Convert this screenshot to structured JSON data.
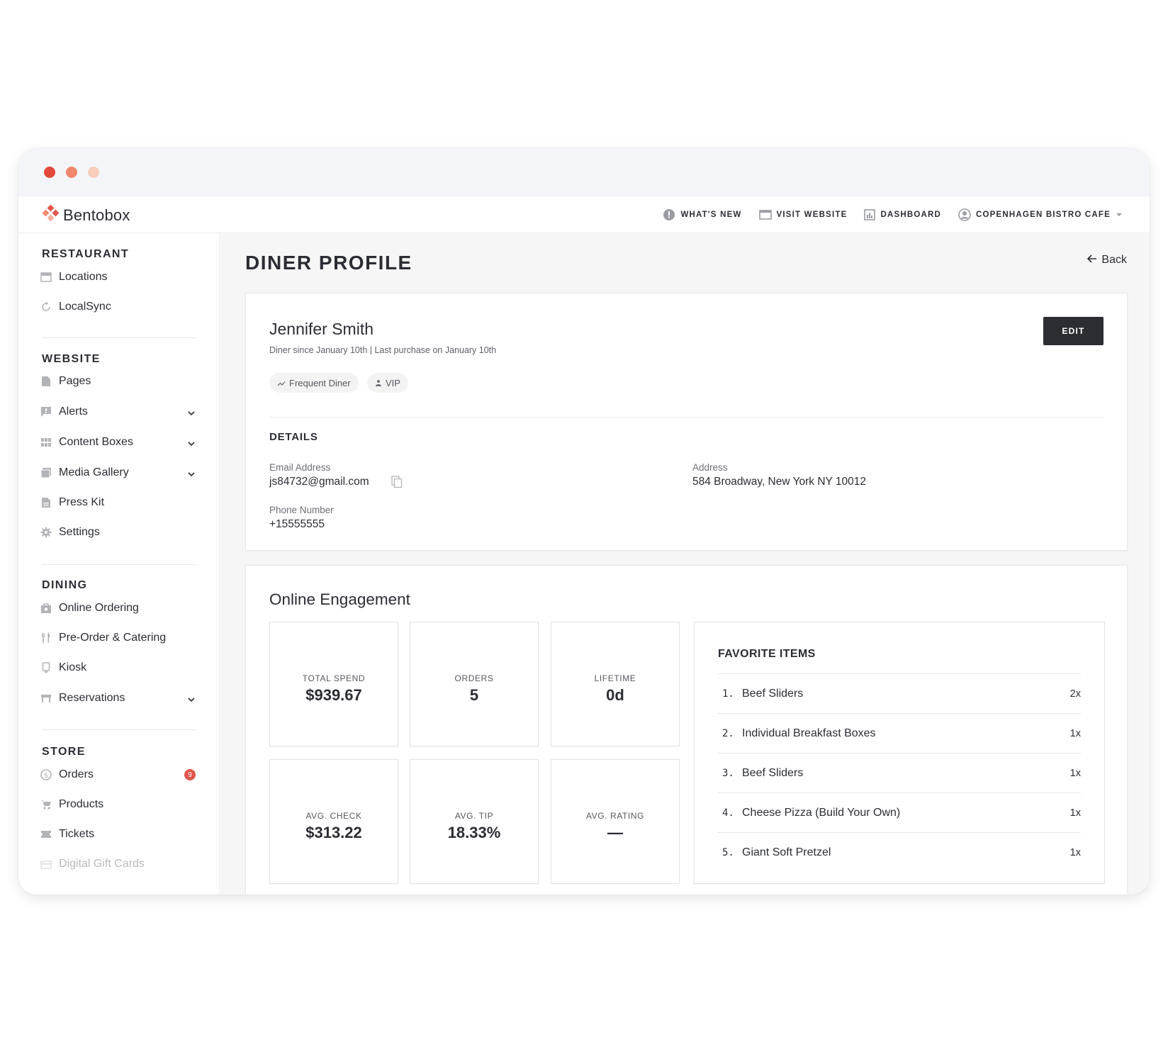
{
  "app": {
    "brand_name": "Bentobox",
    "accent_color": "#e2574c"
  },
  "topnav": {
    "whats_new": "WHAT'S NEW",
    "visit_website": "VISIT WEBSITE",
    "dashboard": "DASHBOARD",
    "account": "COPENHAGEN BISTRO CAFE"
  },
  "sidebar": {
    "sections": [
      {
        "title": "RESTAURANT",
        "items": [
          {
            "label": "Locations",
            "icon": "storefront-icon"
          },
          {
            "label": "LocalSync",
            "icon": "sync-icon"
          }
        ]
      },
      {
        "title": "WEBSITE",
        "items": [
          {
            "label": "Pages",
            "icon": "page-icon"
          },
          {
            "label": "Alerts",
            "icon": "alert-icon",
            "expandable": true
          },
          {
            "label": "Content Boxes",
            "icon": "grid-icon",
            "expandable": true
          },
          {
            "label": "Media Gallery",
            "icon": "gallery-icon",
            "expandable": true
          },
          {
            "label": "Press Kit",
            "icon": "document-icon"
          },
          {
            "label": "Settings",
            "icon": "gear-icon"
          }
        ]
      },
      {
        "title": "DINING",
        "items": [
          {
            "label": "Online Ordering",
            "icon": "bag-icon"
          },
          {
            "label": "Pre-Order & Catering",
            "icon": "utensils-icon"
          },
          {
            "label": "Kiosk",
            "icon": "kiosk-icon"
          },
          {
            "label": "Reservations",
            "icon": "table-icon",
            "expandable": true
          }
        ]
      },
      {
        "title": "STORE",
        "items": [
          {
            "label": "Orders",
            "icon": "dollar-icon",
            "badge": "9"
          },
          {
            "label": "Products",
            "icon": "cart-icon"
          },
          {
            "label": "Tickets",
            "icon": "ticket-icon"
          },
          {
            "label": "Digital Gift Cards",
            "icon": "gift-card-icon"
          }
        ]
      }
    ]
  },
  "page": {
    "title": "DINER PROFILE",
    "back_label": "Back"
  },
  "profile": {
    "name": "Jennifer Smith",
    "since": "Diner since January 10th | Last purchase on January 10th",
    "tags": [
      "Frequent Diner",
      "VIP"
    ],
    "edit_label": "EDIT",
    "details_title": "DETAILS",
    "email_label": "Email Address",
    "email": "js84732@gmail.com",
    "phone_label": "Phone Number",
    "phone": "+15555555",
    "address_label": "Address",
    "address": "584 Broadway, New York NY 10012"
  },
  "engagement": {
    "title": "Online Engagement",
    "stats": [
      {
        "label": "TOTAL SPEND",
        "value": "$939.67"
      },
      {
        "label": "ORDERS",
        "value": "5"
      },
      {
        "label": "LIFETIME",
        "value": "0d"
      },
      {
        "label": "AVG. CHECK",
        "value": "$313.22"
      },
      {
        "label": "AVG. TIP",
        "value": "18.33%"
      },
      {
        "label": "AVG. RATING",
        "value": "—"
      }
    ],
    "favorites_title": "FAVORITE ITEMS",
    "favorites": [
      {
        "num": "1.",
        "name": "Beef Sliders",
        "count": "2x"
      },
      {
        "num": "2.",
        "name": "Individual Breakfast Boxes",
        "count": "1x"
      },
      {
        "num": "3.",
        "name": "Beef Sliders",
        "count": "1x"
      },
      {
        "num": "4.",
        "name": "Cheese Pizza (Build Your Own)",
        "count": "1x"
      },
      {
        "num": "5.",
        "name": "Giant Soft Pretzel",
        "count": "1x"
      }
    ]
  }
}
